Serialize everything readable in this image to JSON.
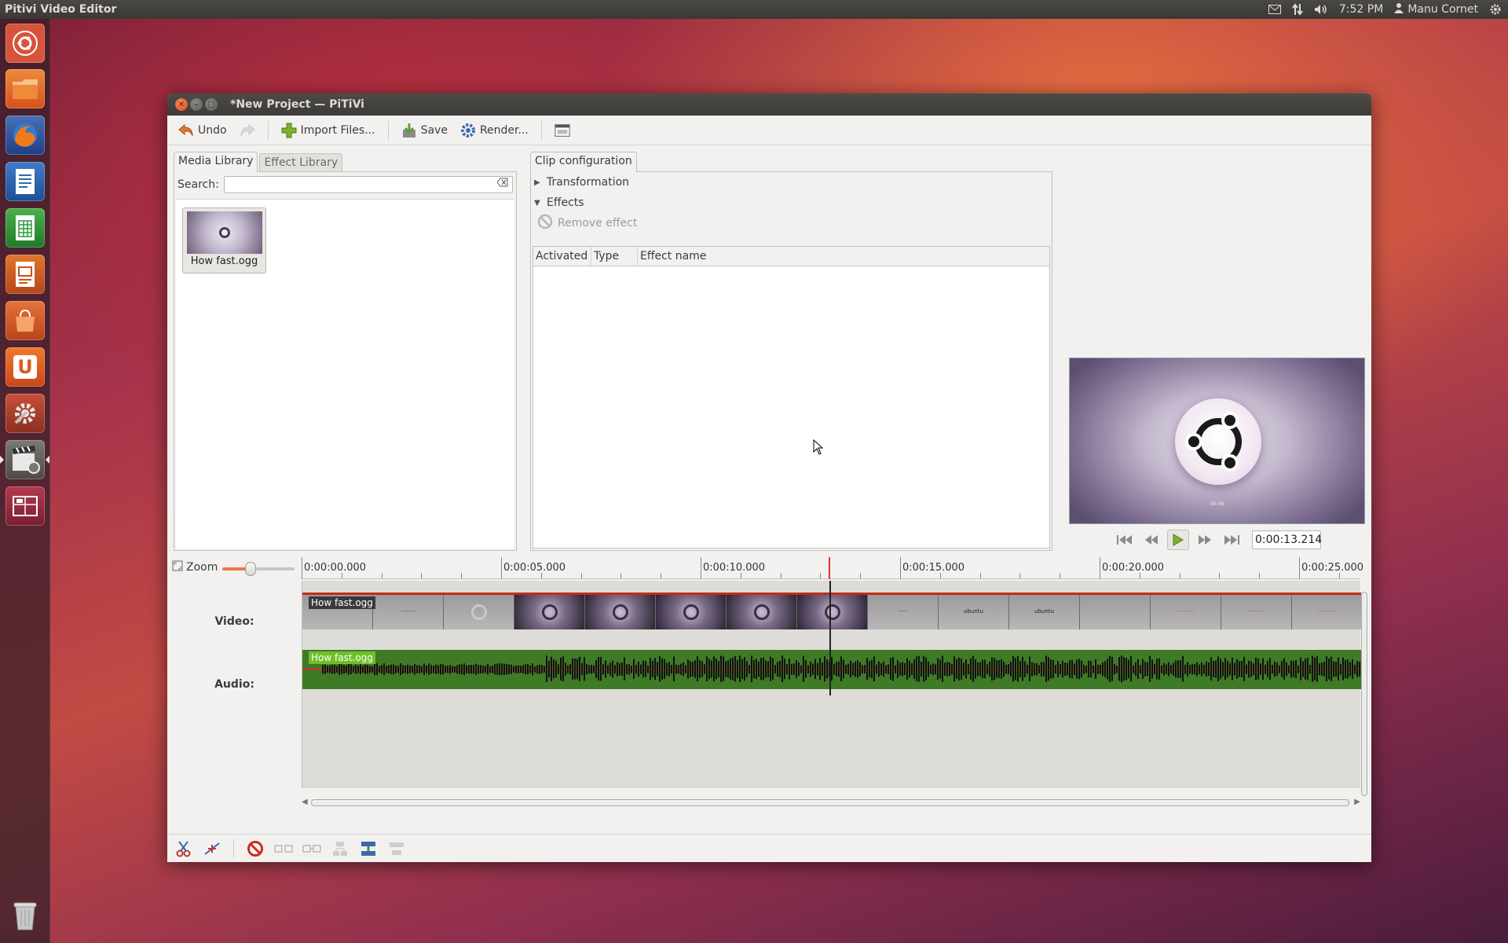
{
  "top_panel": {
    "app_title": "Pitivi Video Editor",
    "clock": "7:52 PM",
    "user": "Manu Cornet",
    "icons": [
      "mail-icon",
      "network-icon",
      "volume-icon",
      "user-icon",
      "session-gear-icon"
    ]
  },
  "launcher": {
    "items": [
      {
        "name": "dash-home-icon",
        "color": "#d8533b"
      },
      {
        "name": "files-folder-icon",
        "color": "#e36a2a"
      },
      {
        "name": "firefox-icon",
        "color": "#d6421e"
      },
      {
        "name": "libreoffice-writer-icon",
        "color": "#2a6db3"
      },
      {
        "name": "libreoffice-calc-icon",
        "color": "#3a9a3a"
      },
      {
        "name": "libreoffice-impress-icon",
        "color": "#c8551c"
      },
      {
        "name": "software-center-icon",
        "color": "#d7582a"
      },
      {
        "name": "ubuntu-one-icon",
        "color": "#de6a22"
      },
      {
        "name": "system-settings-icon",
        "color": "#b8432e"
      },
      {
        "name": "pitivi-icon",
        "color": "#5d5c58"
      },
      {
        "name": "workspace-switcher-icon",
        "color": "#8a2b3a"
      },
      {
        "name": "trash-icon",
        "color": "#6b6b6b"
      }
    ]
  },
  "window": {
    "title": "*New Project — PiTiVi"
  },
  "toolbar": {
    "undo_label": "Undo",
    "import_label": "Import Files...",
    "save_label": "Save",
    "render_label": "Render..."
  },
  "media_library": {
    "tabs": [
      "Media Library",
      "Effect Library"
    ],
    "search_label": "Search:",
    "search_value": "",
    "items": [
      {
        "label": "How fast.ogg"
      }
    ]
  },
  "clip_config": {
    "tab": "Clip configuration",
    "transformation_label": "Transformation",
    "effects_label": "Effects",
    "remove_effect_label": "Remove effect",
    "columns": [
      "Activated",
      "Type",
      "Effect name"
    ]
  },
  "viewer": {
    "timecode": "0:00:13.214",
    "caption": "00:08"
  },
  "timeline": {
    "zoom_label": "Zoom",
    "zoom_level": 0.36,
    "ruler_labels": [
      "0:00:00.000",
      "0:00:05.000",
      "0:00:10.000",
      "0:00:15.000",
      "0:00:20.000",
      "0:00:25.000"
    ],
    "video_label": "Video:",
    "audio_label": "Audio:",
    "video_clip_name": "How fast.ogg",
    "audio_clip_name": "How fast.ogg",
    "frame_words": [
      "ubuntu",
      "ubuntu"
    ]
  }
}
